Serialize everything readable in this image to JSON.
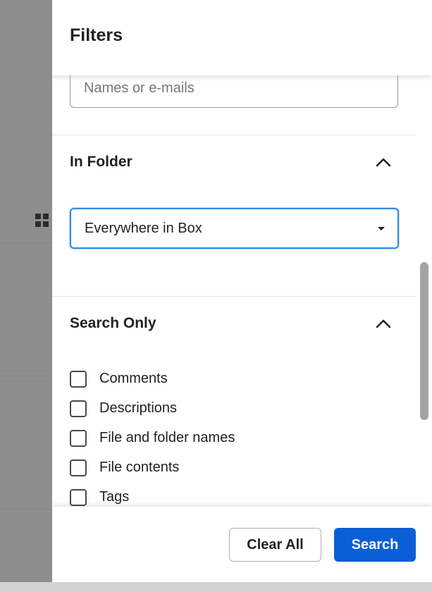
{
  "panel": {
    "title": "Filters",
    "owner_input_placeholder": "Names or e-mails"
  },
  "sections": {
    "in_folder": {
      "title": "In Folder",
      "selected_value": "Everywhere in Box",
      "expanded": true
    },
    "search_only": {
      "title": "Search Only",
      "expanded": true,
      "options": [
        {
          "label": "Comments",
          "checked": false
        },
        {
          "label": "Descriptions",
          "checked": false
        },
        {
          "label": "File and folder names",
          "checked": false
        },
        {
          "label": "File contents",
          "checked": false
        },
        {
          "label": "Tags",
          "checked": false
        }
      ]
    }
  },
  "footer": {
    "clear_label": "Clear All",
    "search_label": "Search"
  },
  "icons": {
    "collapse": "chevron-up-icon",
    "dropdown": "caret-down-icon",
    "background_view": "grid-view-icon"
  },
  "colors": {
    "primary": "#0b5fd6",
    "focus_border": "#2f8ae5",
    "overlay": "#8e8e8e"
  }
}
